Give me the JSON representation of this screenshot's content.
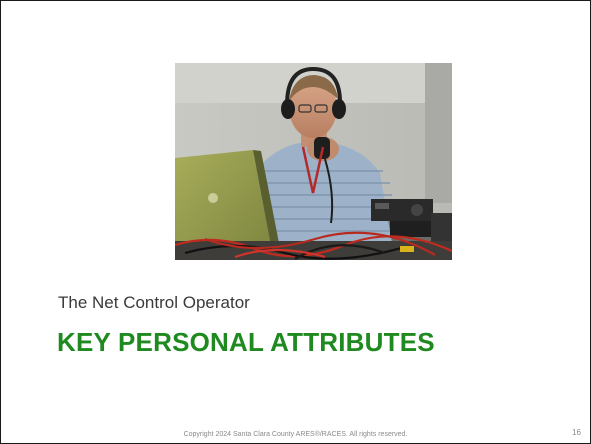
{
  "slide": {
    "photo_description_icon": "radio-operator-photo",
    "subtitle": "The Net Control Operator",
    "title": "KEY PERSONAL ATTRIBUTES",
    "footer": "Copyright 2024 Santa Clara County ARES®/RACES.  All rights reserved.",
    "page_number": "16"
  },
  "colors": {
    "title": "#1f8a1f",
    "subtitle": "#3a3a3a",
    "footer": "#8a8a8a",
    "border": "#1a1a1a"
  }
}
